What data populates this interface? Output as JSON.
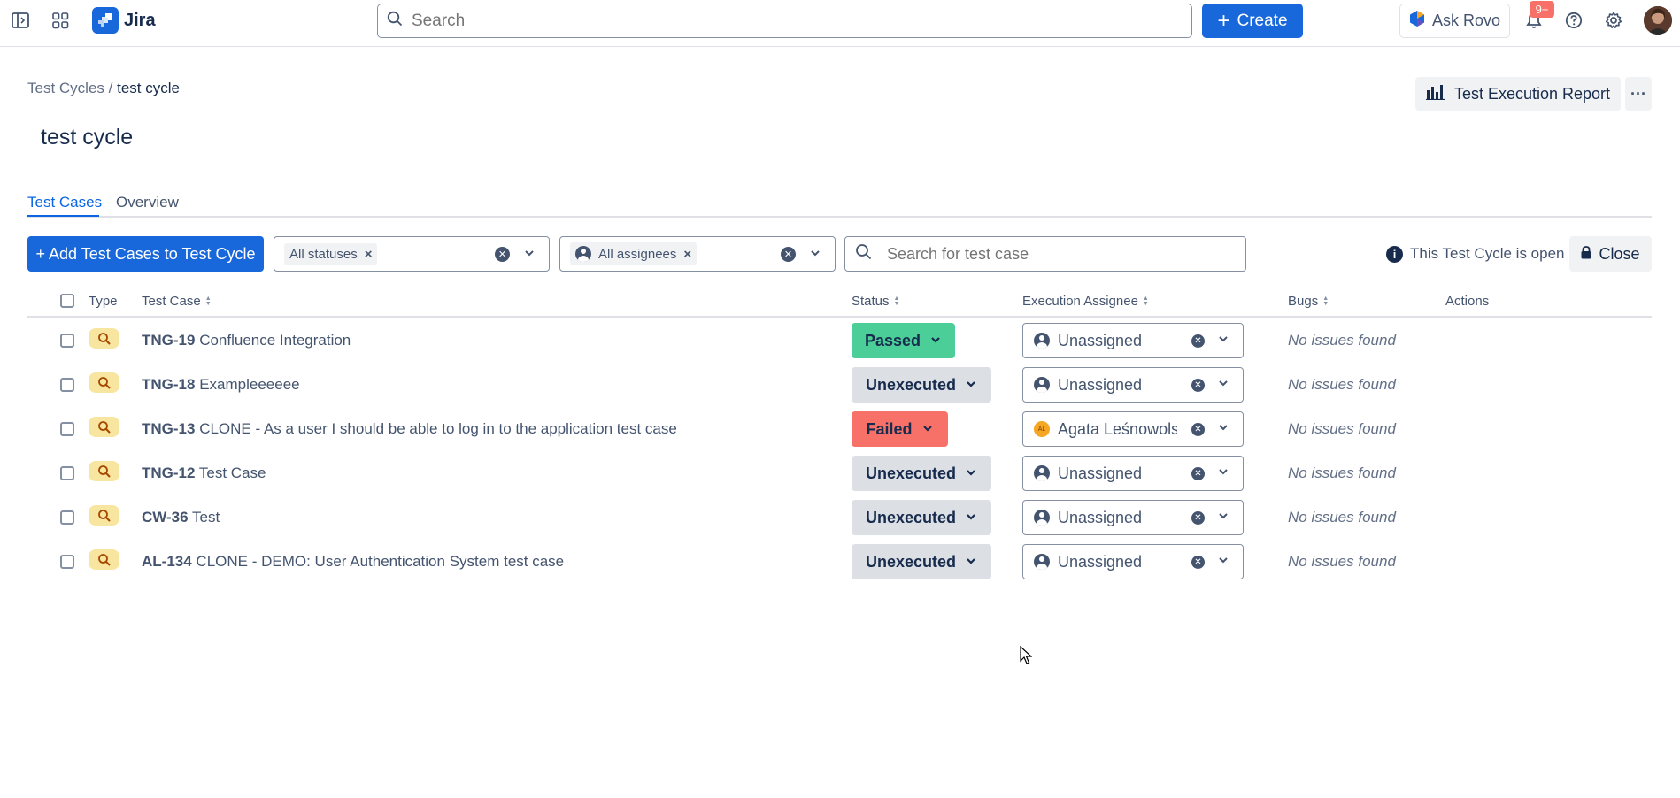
{
  "topnav": {
    "app_name": "Jira",
    "search_placeholder": "Search",
    "create_label": "Create",
    "ask_rovo_label": "Ask Rovo",
    "notification_count": "9+"
  },
  "header": {
    "breadcrumb_parent": "Test Cycles",
    "breadcrumb_separator": "/",
    "breadcrumb_current": "test cycle",
    "title": "test cycle",
    "report_button": "Test Execution Report"
  },
  "tabs": [
    {
      "label": "Test Cases",
      "active": true
    },
    {
      "label": "Overview",
      "active": false
    }
  ],
  "toolbar": {
    "add_button": "+ Add Test Cases to Test Cycle",
    "status_filter_chip": "All statuses",
    "assignee_filter_chip": "All assignees",
    "search_placeholder": "Search for test case",
    "open_info": "This Test Cycle is open",
    "close_button": "Close"
  },
  "table": {
    "columns": {
      "type": "Type",
      "test_case": "Test Case",
      "status": "Status",
      "assignee": "Execution Assignee",
      "bugs": "Bugs",
      "actions": "Actions"
    },
    "rows": [
      {
        "key": "TNG-19",
        "title": "Confluence Integration",
        "status": "Passed",
        "status_kind": "passed",
        "assignee": "Unassigned",
        "assignee_kind": "none",
        "bugs": "No issues found"
      },
      {
        "key": "TNG-18",
        "title": "Exampleeeeee",
        "status": "Unexecuted",
        "status_kind": "unexecuted",
        "assignee": "Unassigned",
        "assignee_kind": "none",
        "bugs": "No issues found"
      },
      {
        "key": "TNG-13",
        "title": "CLONE - As a user I should be able to log in to the application test case",
        "status": "Failed",
        "status_kind": "failed",
        "assignee": "Agata Leśnowolsl",
        "assignee_kind": "user",
        "assignee_initials": "AL",
        "bugs": "No issues found"
      },
      {
        "key": "TNG-12",
        "title": "Test Case",
        "status": "Unexecuted",
        "status_kind": "unexecuted",
        "assignee": "Unassigned",
        "assignee_kind": "none",
        "bugs": "No issues found"
      },
      {
        "key": "CW-36",
        "title": "Test",
        "status": "Unexecuted",
        "status_kind": "unexecuted",
        "assignee": "Unassigned",
        "assignee_kind": "none",
        "bugs": "No issues found"
      },
      {
        "key": "AL-134",
        "title": "CLONE - DEMO: User Authentication System test case",
        "status": "Unexecuted",
        "status_kind": "unexecuted",
        "assignee": "Unassigned",
        "assignee_kind": "none",
        "bugs": "No issues found"
      }
    ]
  },
  "colors": {
    "brand_blue": "#1868db",
    "passed": "#4bce97",
    "failed": "#f87168",
    "unexecuted": "#dcdfe4",
    "test_type_icon": "#f8e6a0"
  },
  "icons": {
    "sidebar_toggle": "sidebar-toggle-icon",
    "app_switcher": "app-switcher-icon",
    "search": "search-icon",
    "notifications": "bell-icon",
    "help": "help-icon",
    "settings": "gear-icon",
    "report": "bar-chart-icon",
    "lock": "lock-icon",
    "info": "info-icon",
    "test_type": "magnifier-icon"
  }
}
